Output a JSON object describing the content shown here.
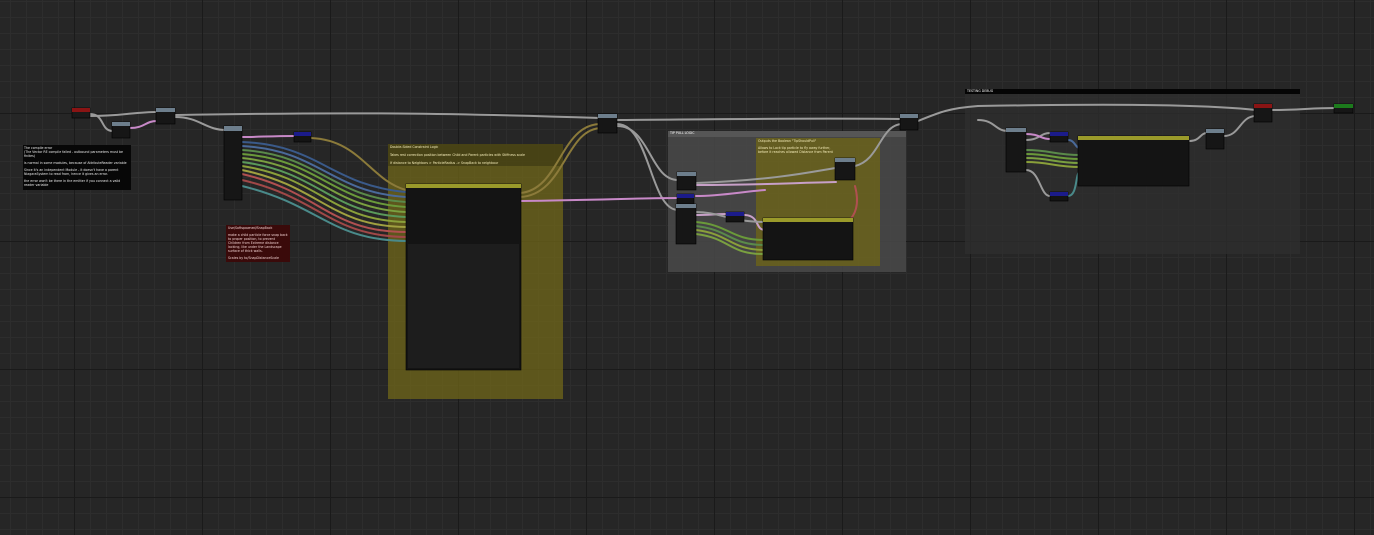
{
  "graph": {
    "comment_compile": {
      "lines": [
        "The compile error",
        "(The Vector RE compile failed - outbound parameters must be finites)",
        "is normal in some modules, because of AttributeReader variable",
        "Since it's an independent Module - it doesn't have a parent NiagaraSystem to read from, hence it gives an error.",
        "the error won't be there in the emitter if you connect a valid reader variable"
      ]
    },
    "comment_snapback": {
      "title": "Use/Softspawned/SnapBack",
      "lines": [
        "make a child particle force snap back to proper position, to prevent Children from Extreme distance lacking, like under the Landscape surface of thick walls.",
        "Scales by to/SnapDistanceScale"
      ]
    },
    "group_constraint": {
      "title": "Double-Sided Constraint Logic",
      "line1": "Takes rest correction position between Child and Parent particles with Stiffness scale",
      "line2": "If distance to Neighbors > ParticleRadius -> SnapBack to neighbour"
    },
    "group_tip": {
      "title": "TIP PULL LOGIC"
    },
    "group_tip_inner": {
      "title": "Outputs the Boolean \"TipShouldPull\"",
      "line1": "Allows to Lock tip particle to fly away further,",
      "line2": "before it reaches allowed Distance from Parent"
    },
    "group_testing": {
      "title": "TESTING DEBUG"
    }
  }
}
